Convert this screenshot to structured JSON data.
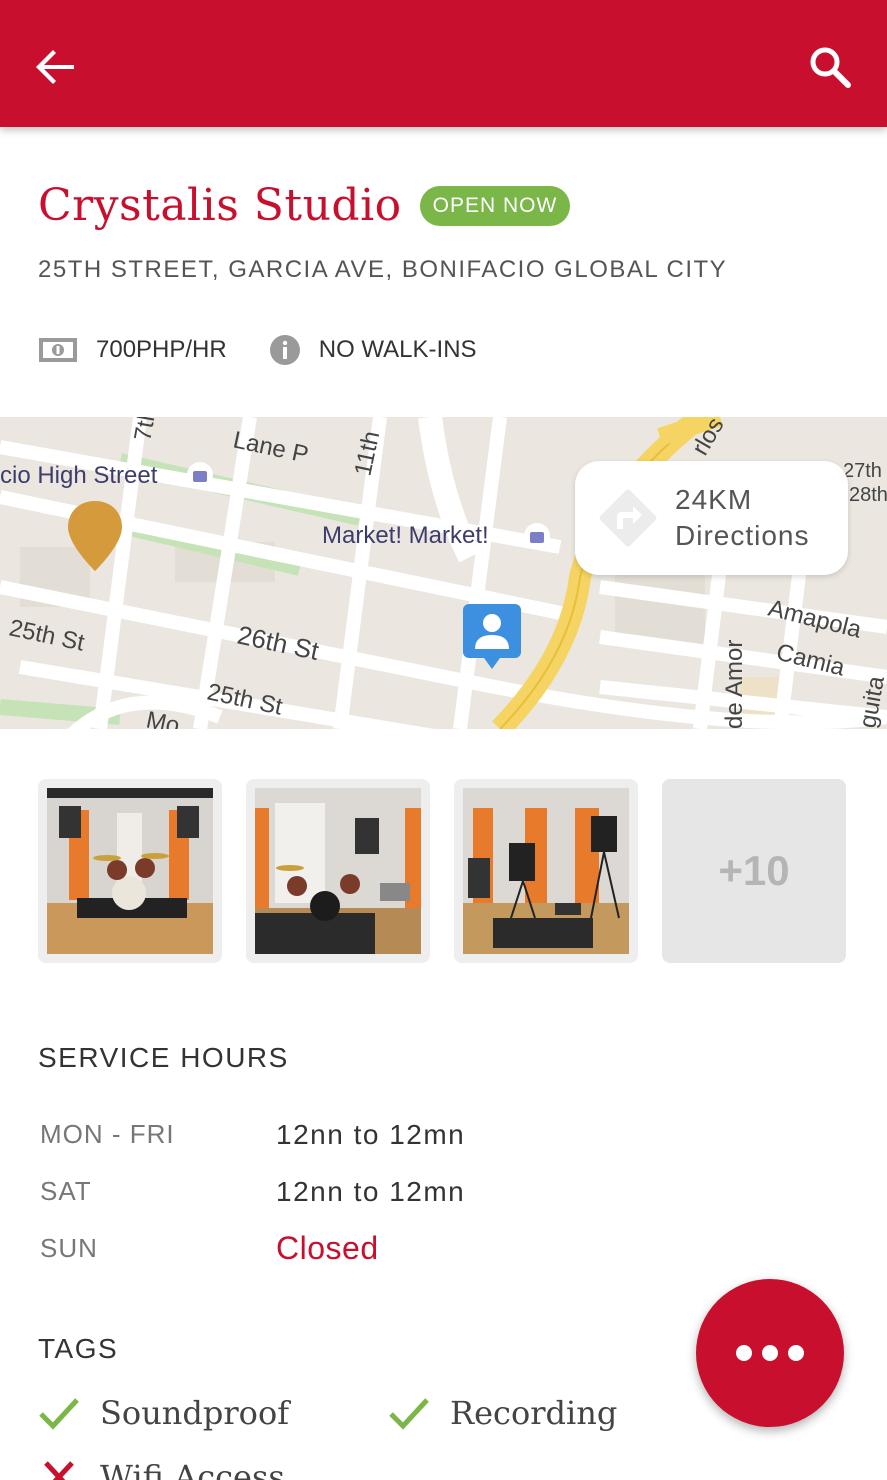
{
  "header": {
    "back_icon": "arrow-left-icon",
    "search_icon": "search-icon",
    "color": "#c8102e"
  },
  "studio": {
    "name": "Crystalis Studio",
    "status": "OPEN NOW",
    "address": "25TH STREET, GARCIA AVE, BONIFACIO GLOBAL CITY",
    "rate": "700PHP/HR",
    "walkin_note": "NO WALK-INS"
  },
  "map": {
    "street_labels": [
      "Lane P",
      "7th",
      "11th",
      "cio High Street",
      "Market! Market!",
      "25th St",
      "26th St",
      "25th St",
      "Amapola",
      "Camia",
      "de Amor",
      "27th",
      "28th",
      "rlos",
      "Mo",
      "guita"
    ],
    "directions": {
      "distance": "24KM",
      "label": "Directions"
    }
  },
  "gallery": {
    "more_label": "+10"
  },
  "service_hours": {
    "title": "SERVICE HOURS",
    "rows": [
      {
        "day": "MON - FRI",
        "time": "12nn to 12mn"
      },
      {
        "day": "SAT",
        "time": "12nn to 12mn"
      },
      {
        "day": "SUN",
        "time": "Closed"
      }
    ]
  },
  "tags": {
    "title": "TAGS",
    "items": [
      {
        "label": "Soundproof",
        "available": true
      },
      {
        "label": "Recording",
        "available": true
      },
      {
        "label": "Wifi Access",
        "available": false
      }
    ]
  },
  "colors": {
    "accent": "#c8102e",
    "open": "#7ab648",
    "check": "#7ab648",
    "cross": "#c8102e"
  }
}
